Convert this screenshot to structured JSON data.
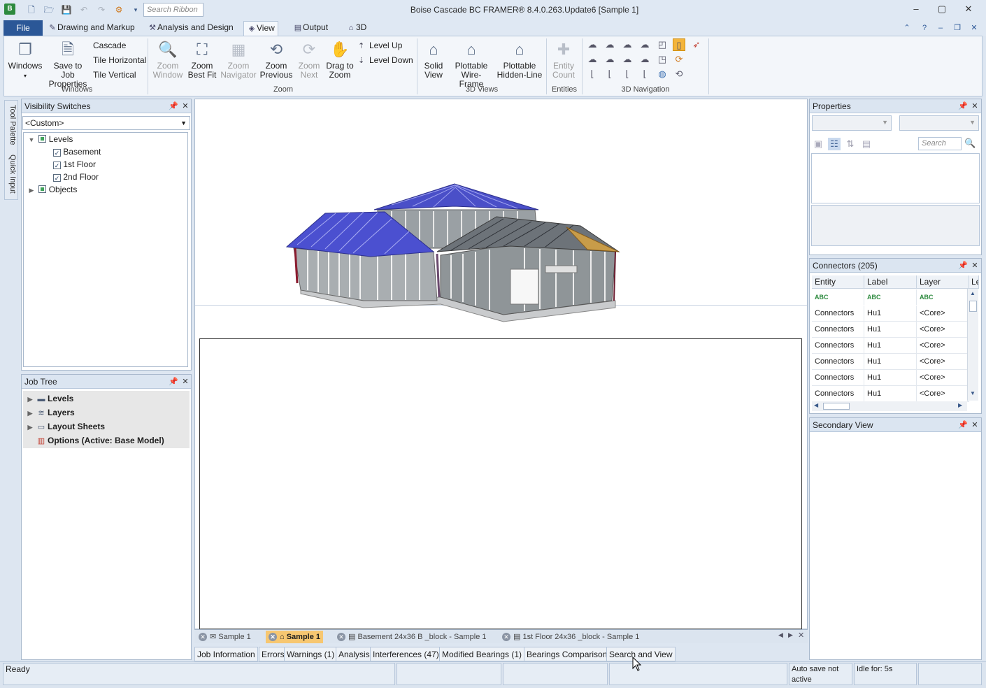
{
  "window": {
    "title": "Boise Cascade BC FRAMER® 8.4.0.263.Update6  [Sample 1]",
    "ribbon_search_placeholder": "Search Ribbon"
  },
  "tabs": {
    "file": "File",
    "drawing": "Drawing and Markup",
    "analysis": "Analysis and Design",
    "view": "View",
    "output": "Output",
    "three_d": "3D"
  },
  "ribbon": {
    "windows_group": {
      "label": "Windows",
      "windows": "Windows",
      "save_to_job_1": "Save to Job",
      "save_to_job_2": "Properties",
      "cascade": "Cascade",
      "tile_horizontal": "Tile Horizontal",
      "tile_vertical": "Tile Vertical"
    },
    "zoom_group": {
      "label": "Zoom",
      "zoom_window_1": "Zoom",
      "zoom_window_2": "Window",
      "zoom_best_fit_1": "Zoom",
      "zoom_best_fit_2": "Best Fit",
      "zoom_navigator_1": "Zoom",
      "zoom_navigator_2": "Navigator",
      "zoom_previous_1": "Zoom",
      "zoom_previous_2": "Previous",
      "zoom_next_1": "Zoom",
      "zoom_next_2": "Next",
      "drag_to_zoom_1": "Drag to",
      "drag_to_zoom_2": "Zoom",
      "level_up": "Level Up",
      "level_down": "Level Down"
    },
    "views_group": {
      "label": "3D Views",
      "solid_1": "Solid",
      "solid_2": "View",
      "wire_1": "Plottable",
      "wire_2": "Wire-Frame",
      "hidden_1": "Plottable",
      "hidden_2": "Hidden-Line"
    },
    "entities_group": {
      "label": "Entities",
      "count_1": "Entity",
      "count_2": "Count"
    },
    "nav_group": {
      "label": "3D Navigation"
    }
  },
  "side_tabs": {
    "tool_palette": "Tool Palette",
    "quick_input": "Quick Input"
  },
  "visibility": {
    "title": "Visibility Switches",
    "selected": "<Custom>",
    "tree": {
      "levels": "Levels",
      "basement": "Basement",
      "first_floor": "1st Floor",
      "second_floor": "2nd Floor",
      "objects": "Objects"
    }
  },
  "job_tree": {
    "title": "Job Tree",
    "levels": "Levels",
    "layers": "Layers",
    "layout_sheets": "Layout Sheets",
    "options": "Options (Active: Base Model)"
  },
  "doc_tabs": {
    "sample1_plan": "Sample 1",
    "sample1_3d": "Sample 1",
    "basement": "Basement 24x36 B _block - Sample 1",
    "first_floor": "1st Floor 24x36 _block - Sample 1"
  },
  "output_tabs": {
    "job_info": "Job Information",
    "errors": "Errors",
    "warnings": "Warnings (1)",
    "analysis": "Analysis",
    "interferences": "Interferences (47)",
    "modified_bearings": "Modified Bearings (1)",
    "bearings_comparison": "Bearings Comparison",
    "search_view": "Search and View"
  },
  "properties": {
    "title": "Properties",
    "search_placeholder": "Search"
  },
  "connectors": {
    "title": "Connectors (205)",
    "columns": [
      "Entity",
      "Label",
      "Layer",
      "Le"
    ],
    "filter_glyph": "ABC",
    "rows": [
      [
        "Connectors",
        "Hu1",
        "<Core>"
      ],
      [
        "Connectors",
        "Hu1",
        "<Core>"
      ],
      [
        "Connectors",
        "Hu1",
        "<Core>"
      ],
      [
        "Connectors",
        "Hu1",
        "<Core>"
      ],
      [
        "Connectors",
        "Hu1",
        "<Core>"
      ],
      [
        "Connectors",
        "Hu1",
        "<Core>"
      ]
    ]
  },
  "secondary_view": {
    "title": "Secondary View"
  },
  "status": {
    "ready": "Ready",
    "autosave_1": "Auto save not",
    "autosave_2": "active",
    "idle": "Idle for: 5s"
  },
  "colors": {
    "file_tab": "#2b5797",
    "active_doc_tab": "#f7c771",
    "roof_blue": "#4a4fc8",
    "wall_grey": "#9aa0a4"
  }
}
